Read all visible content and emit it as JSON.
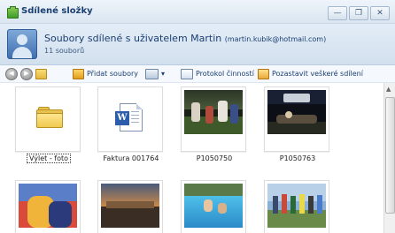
{
  "window": {
    "title": "Sdílené složky",
    "buttons": [
      "—",
      "❐",
      "✕"
    ]
  },
  "header": {
    "main_text": "Soubory sdílené s uživatelem Martin",
    "email": "(martin.kubik@hotmail.com)",
    "count": "11 souborů"
  },
  "toolbar": {
    "add_files": "Přidat soubory",
    "view_arrow": "▾",
    "activity_log": "Protokol činností",
    "stop_sharing": "Pozastavit veškeré sdílení"
  },
  "items": [
    {
      "label": "Výlet - foto",
      "kind": "folder",
      "selected": true
    },
    {
      "label": "Faktura 001764",
      "kind": "word-document"
    },
    {
      "label": "P1050750",
      "kind": "photo"
    },
    {
      "label": "P1050763",
      "kind": "photo"
    },
    {
      "label": "",
      "kind": "photo"
    },
    {
      "label": "",
      "kind": "photo"
    },
    {
      "label": "",
      "kind": "photo"
    },
    {
      "label": "",
      "kind": "photo"
    }
  ],
  "icons": {
    "back": "back-arrow-icon",
    "forward": "forward-arrow-icon",
    "folder": "folder-icon",
    "word": "word-document-icon"
  },
  "colors": {
    "title_text": "#1b3f72",
    "header_bg": "#d8e5f2"
  }
}
